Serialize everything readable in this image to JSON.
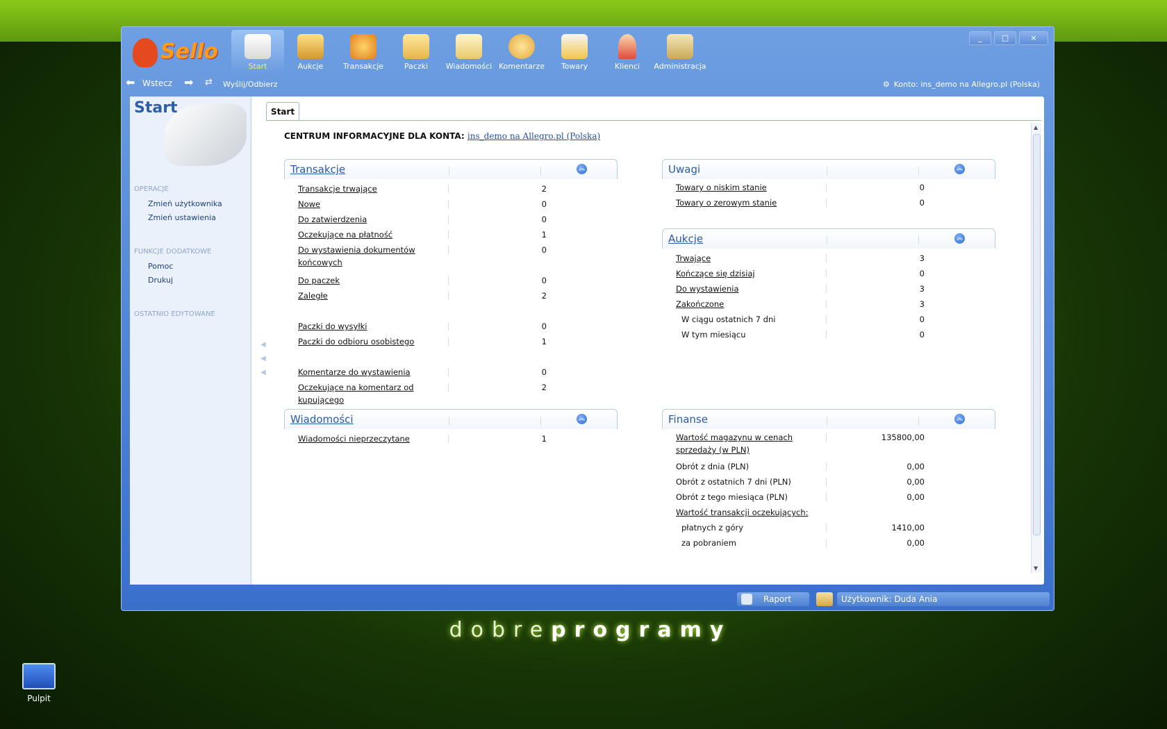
{
  "app": {
    "logo_text": "Sello",
    "nav": [
      {
        "label": "Start",
        "icon": "home-icon",
        "active": true
      },
      {
        "label": "Aukcje",
        "icon": "gavel-icon"
      },
      {
        "label": "Transakcje",
        "icon": "transactions-icon"
      },
      {
        "label": "Paczki",
        "icon": "package-icon"
      },
      {
        "label": "Wiadomości",
        "icon": "messages-icon"
      },
      {
        "label": "Komentarze",
        "icon": "comments-icon"
      },
      {
        "label": "Towary",
        "icon": "goods-icon"
      },
      {
        "label": "Klienci",
        "icon": "clients-icon"
      },
      {
        "label": "Administracja",
        "icon": "admin-icon"
      }
    ],
    "window_controls": {
      "minimize": "_",
      "maximize": "□",
      "close": "×"
    }
  },
  "toolbar": {
    "back_label": "Wstecz",
    "send_receive_label": "Wyślij/Odbierz",
    "account_label": "Konto: ins_demo na Allegro.pl (Polska)"
  },
  "sidebar": {
    "title": "Start",
    "sections": [
      {
        "header": "OPERACJE",
        "links": [
          "Zmień użytkownika",
          "Zmień ustawienia"
        ]
      },
      {
        "header": "FUNKCJE DODATKOWE",
        "links": [
          "Pomoc",
          "Drukuj"
        ]
      },
      {
        "header": "OSTATNIO EDYTOWANE",
        "links": []
      }
    ]
  },
  "tab": {
    "label": "Start"
  },
  "info_center": {
    "prefix": "CENTRUM INFORMACYJNE  DLA KONTA:",
    "account_link": "ins_demo na Allegro.pl (Polska)"
  },
  "panels": {
    "transakcje": {
      "title": "Transakcje",
      "rows": [
        {
          "label": "Transakcje trwające",
          "value": "2"
        },
        {
          "label": "Nowe",
          "value": "0"
        },
        {
          "label": "Do zatwierdzenia",
          "value": "0"
        },
        {
          "label": "Oczekujące na płatność",
          "value": "1"
        },
        {
          "label": "Do wystawienia dokumentów końcowych",
          "value": "0"
        },
        {
          "label": "Do paczek",
          "value": "0"
        },
        {
          "label": "Zaległe",
          "value": "2"
        },
        {
          "label": "Paczki do wysyłki",
          "value": "0"
        },
        {
          "label": "Paczki do odbioru osobistego",
          "value": "1"
        },
        {
          "label": "Komentarze do wystawienia",
          "value": "0"
        },
        {
          "label": "Oczekujące na komentarz od kupującego",
          "value": "2"
        }
      ]
    },
    "wiadomosci": {
      "title": "Wiadomości",
      "rows": [
        {
          "label": "Wiadomości nieprzeczytane",
          "value": "1"
        }
      ]
    },
    "uwagi": {
      "title": "Uwagi",
      "rows": [
        {
          "label": "Towary o niskim stanie",
          "value": "0"
        },
        {
          "label": "Towary o zerowym stanie",
          "value": "0"
        }
      ]
    },
    "aukcje": {
      "title": "Aukcje",
      "rows": [
        {
          "label": "Trwające",
          "value": "3"
        },
        {
          "label": "Kończące się dzisiaj",
          "value": "0"
        },
        {
          "label": "Do wystawienia",
          "value": "3"
        },
        {
          "label": "Zakończone",
          "value": "3"
        },
        {
          "label": "W ciągu ostatnich 7 dni",
          "value": "0"
        },
        {
          "label": "W tym miesiącu",
          "value": "0"
        }
      ]
    },
    "finanse": {
      "title": "Finanse",
      "rows": [
        {
          "label": "Wartość magazynu w cenach sprzedaży (w PLN)",
          "value": "135800,00"
        },
        {
          "label": "Obrót z dnia (PLN)",
          "value": "0,00"
        },
        {
          "label": "Obrót z ostatnich 7 dni (PLN)",
          "value": "0,00"
        },
        {
          "label": "Obrót z tego miesiąca (PLN)",
          "value": "0,00"
        },
        {
          "label": "Wartość transakcji oczekujących:",
          "value": ""
        },
        {
          "label": "płatnych z góry",
          "value": "1410,00"
        },
        {
          "label": "za pobraniem",
          "value": "0,00"
        }
      ]
    }
  },
  "statusbar": {
    "report_label": "Raport",
    "user_label": "Użytkownik: Duda Ania"
  },
  "desktop": {
    "brand_light": "dobre",
    "brand_bold": "programy",
    "icon_label": "Pulpit"
  }
}
